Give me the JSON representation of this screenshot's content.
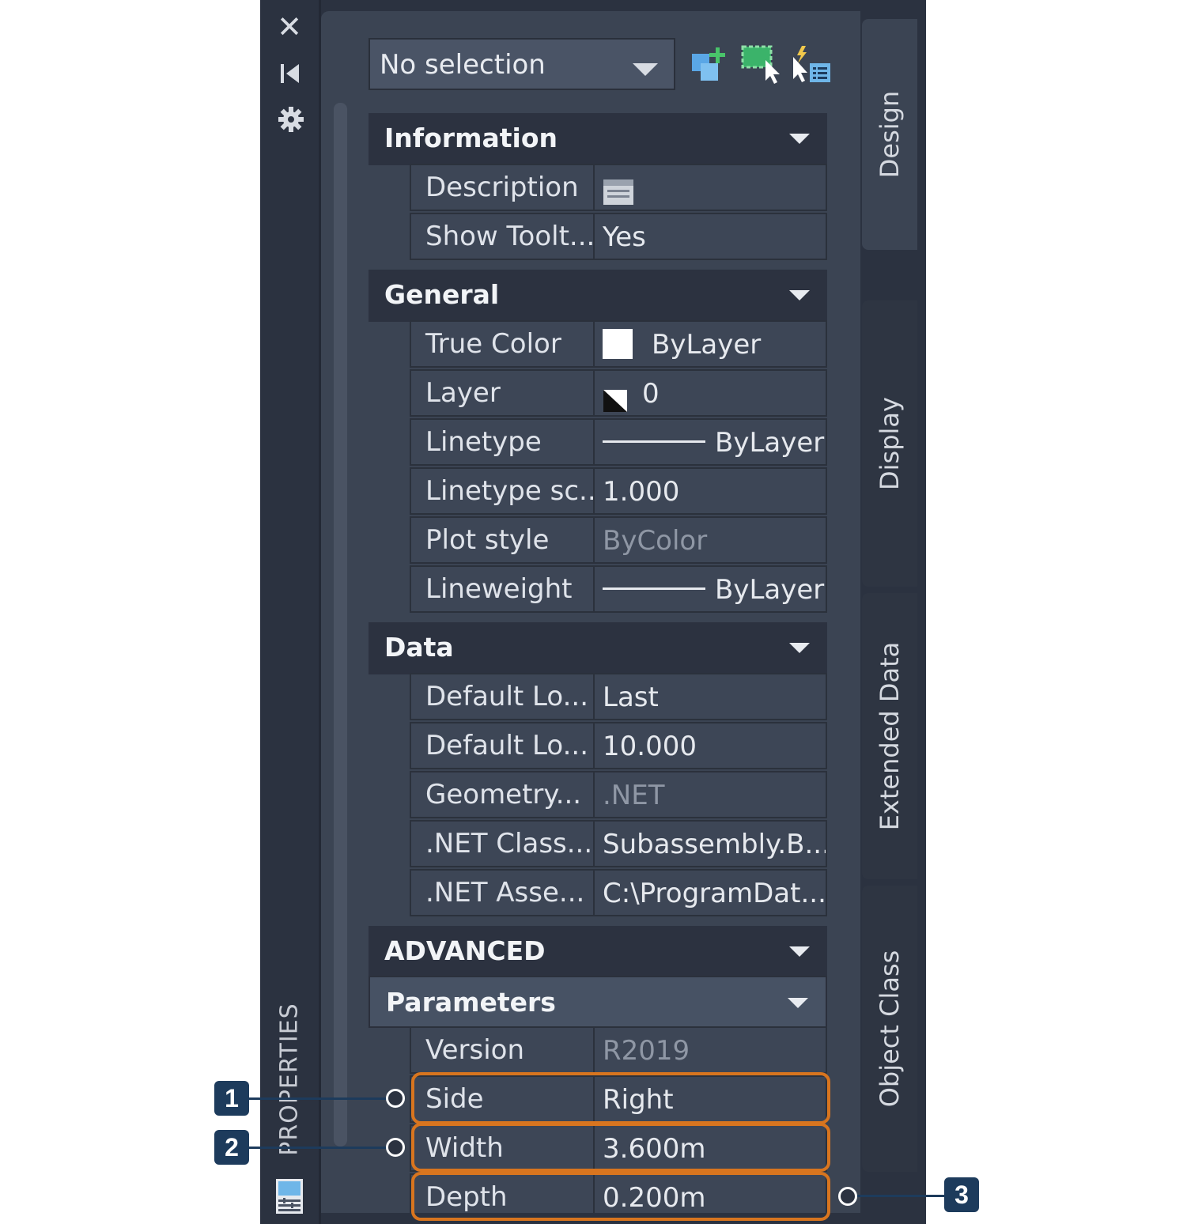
{
  "palette": {
    "title": "PROPERTIES",
    "titlebar_icons": [
      "close-icon",
      "auto-hide-icon",
      "settings-icon"
    ]
  },
  "toolbar": {
    "selection_value": "No selection",
    "buttons": [
      "quick-select-icon",
      "select-objects-icon",
      "toggle-pickadd-icon"
    ]
  },
  "sections": {
    "information": {
      "label": "Information",
      "rows": [
        {
          "key": "Description",
          "value": ""
        },
        {
          "key": "Show Toolt...",
          "value": "Yes"
        }
      ]
    },
    "general": {
      "label": "General",
      "rows": [
        {
          "key": "True Color",
          "value": "ByLayer"
        },
        {
          "key": "Layer",
          "value": "0"
        },
        {
          "key": "Linetype",
          "value": "ByLayer"
        },
        {
          "key": "Linetype sc...",
          "value": "1.000"
        },
        {
          "key": "Plot style",
          "value": "ByColor"
        },
        {
          "key": "Lineweight",
          "value": "ByLayer"
        }
      ]
    },
    "data": {
      "label": "Data",
      "rows": [
        {
          "key": "Default Lo...",
          "value": "Last"
        },
        {
          "key": "Default Lo...",
          "value": "10.000"
        },
        {
          "key": "Geometry...",
          "value": ".NET"
        },
        {
          "key": ".NET Class...",
          "value": "Subassembly.B..."
        },
        {
          "key": ".NET Asse...",
          "value": "C:\\ProgramDat..."
        }
      ]
    },
    "advanced": {
      "label": "ADVANCED",
      "parameters": {
        "label": "Parameters",
        "rows": [
          {
            "key": "Version",
            "value": "R2019"
          },
          {
            "key": "Side",
            "value": "Right"
          },
          {
            "key": "Width",
            "value": "3.600m"
          },
          {
            "key": "Depth",
            "value": "0.200m"
          }
        ]
      }
    }
  },
  "tabs": [
    "Design",
    "Display",
    "Extended Data",
    "Object Class"
  ],
  "callouts": [
    "1",
    "2",
    "3"
  ],
  "colors": {
    "highlight": "#d8751f",
    "badge": "#1d3b5c",
    "panel": "#3b4453",
    "frame": "#2b3240"
  }
}
